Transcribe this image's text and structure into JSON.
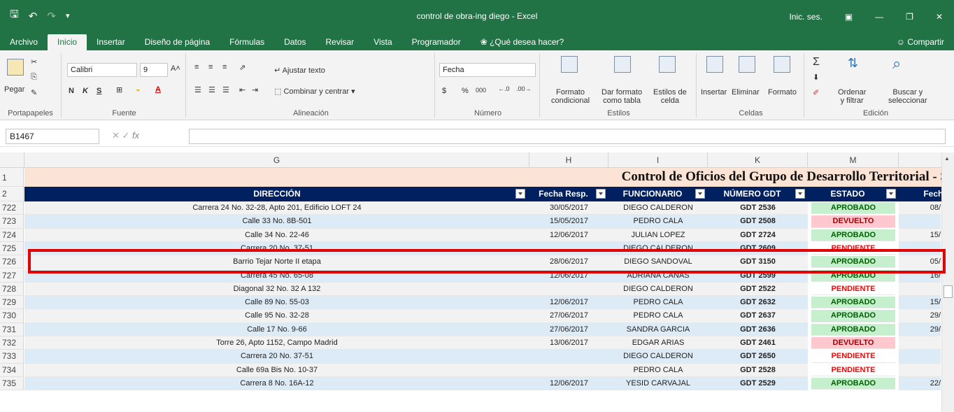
{
  "window": {
    "title": "control de obra-ing diego  -  Excel",
    "sign_in": "Inic. ses.",
    "share": "Compartir"
  },
  "tabs": [
    "Archivo",
    "Inicio",
    "Insertar",
    "Diseño de página",
    "Fórmulas",
    "Datos",
    "Revisar",
    "Vista",
    "Programador"
  ],
  "tell_me": "¿Qué desea hacer?",
  "ribbon": {
    "paste": "Pegar",
    "clipboard_label": "Portapapeles",
    "font_name": "Calibri",
    "font_size": "9",
    "font_label": "Fuente",
    "wrap_text": "Ajustar texto",
    "merge_center": "Combinar y centrar",
    "alignment_label": "Alineación",
    "number_format": "Fecha",
    "currency": "$",
    "percent": "%",
    "thousands": "000",
    "number_label": "Número",
    "cond_format_1": "Formato",
    "cond_format_2": "condicional",
    "format_table_1": "Dar formato",
    "format_table_2": "como tabla",
    "cell_styles_1": "Estilos de",
    "cell_styles_2": "celda",
    "styles_label": "Estilos",
    "insert": "Insertar",
    "delete": "Eliminar",
    "format": "Formato",
    "cells_label": "Celdas",
    "sort_1": "Ordenar",
    "sort_2": "y filtrar",
    "find_1": "Buscar y",
    "find_2": "seleccionar",
    "editing_label": "Edición"
  },
  "formula_bar": {
    "name_box": "B1467",
    "fx": "fx",
    "content": ""
  },
  "columns": [
    "G",
    "H",
    "I",
    "K",
    "M"
  ],
  "row1_num": "1",
  "row2_num": "2",
  "title": "Control de Oficios del Grupo de Desarrollo Territorial - S",
  "headers": {
    "direccion": "DIRECCIÓN",
    "fecha": "Fecha Resp.",
    "funcionario": "FUNCIONARIO",
    "numero": "NÚMERO GDT",
    "estado": "ESTADO",
    "fecha2": "Fecha"
  },
  "rows": [
    {
      "n": "722",
      "dir": "Carrera 24 No. 32-28, Apto 201, Edificio LOFT 24",
      "fecha": "30/05/2017",
      "func": "DIEGO CALDERON",
      "gdt": "GDT 2536",
      "estado": "APROBADO",
      "extra": "08/"
    },
    {
      "n": "723",
      "dir": "Calle 33 No. 8B-501",
      "fecha": "15/05/2017",
      "func": "PEDRO CALA",
      "gdt": "GDT 2508",
      "estado": "DEVUELTO",
      "extra": ""
    },
    {
      "n": "724",
      "dir": "Calle 34 No. 22-46",
      "fecha": "12/06/2017",
      "func": "JULIAN LOPEZ",
      "gdt": "GDT 2724",
      "estado": "APROBADO",
      "extra": "15/"
    },
    {
      "n": "725",
      "dir": "Carrera 20 No. 37-51",
      "fecha": "",
      "func": "DIEGO CALDERON",
      "gdt": "GDT 2609",
      "estado": "PENDIENTE",
      "extra": ""
    },
    {
      "n": "726",
      "dir": "Barrio Tejar Norte II etapa",
      "fecha": "28/06/2017",
      "func": "DIEGO SANDOVAL",
      "gdt": "GDT 3150",
      "estado": "APROBADO",
      "extra": "05/"
    },
    {
      "n": "727",
      "dir": "Carrera 45 No. 65-08",
      "fecha": "12/06/2017",
      "func": "ADRIANA CAÑAS",
      "gdt": "GDT 2599",
      "estado": "APROBADO",
      "extra": "16/"
    },
    {
      "n": "728",
      "dir": "Diagonal 32 No. 32 A 132",
      "fecha": "",
      "func": "DIEGO CALDERON",
      "gdt": "GDT 2522",
      "estado": "PENDIENTE",
      "extra": ""
    },
    {
      "n": "729",
      "dir": "Calle 89 No. 55-03",
      "fecha": "12/06/2017",
      "func": "PEDRO CALA",
      "gdt": "GDT 2632",
      "estado": "APROBADO",
      "extra": "15/"
    },
    {
      "n": "730",
      "dir": "Calle 95 No. 32-28",
      "fecha": "27/06/2017",
      "func": "PEDRO CALA",
      "gdt": "GDT 2637",
      "estado": "APROBADO",
      "extra": "29/"
    },
    {
      "n": "731",
      "dir": "Calle 17 No. 9-66",
      "fecha": "27/06/2017",
      "func": "SANDRA GARCIA",
      "gdt": "GDT 2636",
      "estado": "APROBADO",
      "extra": "29/"
    },
    {
      "n": "732",
      "dir": "Torre 26, Apto 1152, Campo Madrid",
      "fecha": "13/06/2017",
      "func": "EDGAR ARIAS",
      "gdt": "GDT 2461",
      "estado": "DEVUELTO",
      "extra": ""
    },
    {
      "n": "733",
      "dir": "Carrera 20 No. 37-51",
      "fecha": "",
      "func": "DIEGO CALDERON",
      "gdt": "GDT 2650",
      "estado": "PENDIENTE",
      "extra": ""
    },
    {
      "n": "734",
      "dir": "Calle 69a  Bis No. 10-37",
      "fecha": "",
      "func": "PEDRO CALA",
      "gdt": "GDT 2528",
      "estado": "PENDIENTE",
      "extra": ""
    },
    {
      "n": "735",
      "dir": "Carrera 8 No. 16A-12",
      "fecha": "12/06/2017",
      "func": "YESID CARVAJAL",
      "gdt": "GDT 2529",
      "estado": "APROBADO",
      "extra": "22/"
    }
  ],
  "status_colors": {
    "APROBADO": {
      "bg": "#c6efce",
      "fg": "#006100"
    },
    "DEVUELTO": {
      "bg": "#ffc7ce",
      "fg": "#9c0006"
    },
    "PENDIENTE": {
      "bg": "#ffffff",
      "fg": "#ff0000"
    }
  }
}
